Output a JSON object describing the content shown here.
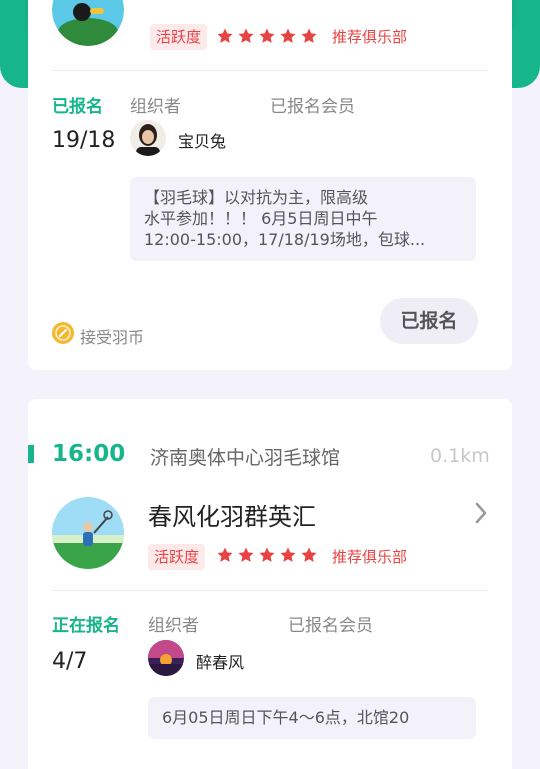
{
  "colors": {
    "brand": "#17b58c",
    "red": "#e84343",
    "bg": "#f4f2fb"
  },
  "card1": {
    "badge_active": "活跃度",
    "rating": 5,
    "recommend": "推荐俱乐部",
    "status": "已报名",
    "organizer_label": "组织者",
    "members_label": "已报名会员",
    "count": "19/18",
    "organizer_name": "宝贝兔",
    "description_lines": [
      "【羽毛球】以对抗为主，限高级",
      "水平参加！！！ 6月5日周日中午",
      "12:00-15:00，17/18/19场地，包球..."
    ],
    "coin_text": "接受羽币",
    "action_label": "已报名"
  },
  "card2": {
    "time": "16:00",
    "venue": "济南奥体中心羽毛球馆",
    "distance": "0.1km",
    "club_name": "春风化羽群英汇",
    "badge_active": "活跃度",
    "rating": 5,
    "recommend": "推荐俱乐部",
    "status": "正在报名",
    "organizer_label": "组织者",
    "members_label": "已报名会员",
    "count": "4/7",
    "organizer_name": "醉春风",
    "description": "6月05日周日下午4～6点，北馆20"
  },
  "icons": {
    "star": "star-icon",
    "coin": "coin-icon",
    "chevron": "chevron-right-icon"
  }
}
